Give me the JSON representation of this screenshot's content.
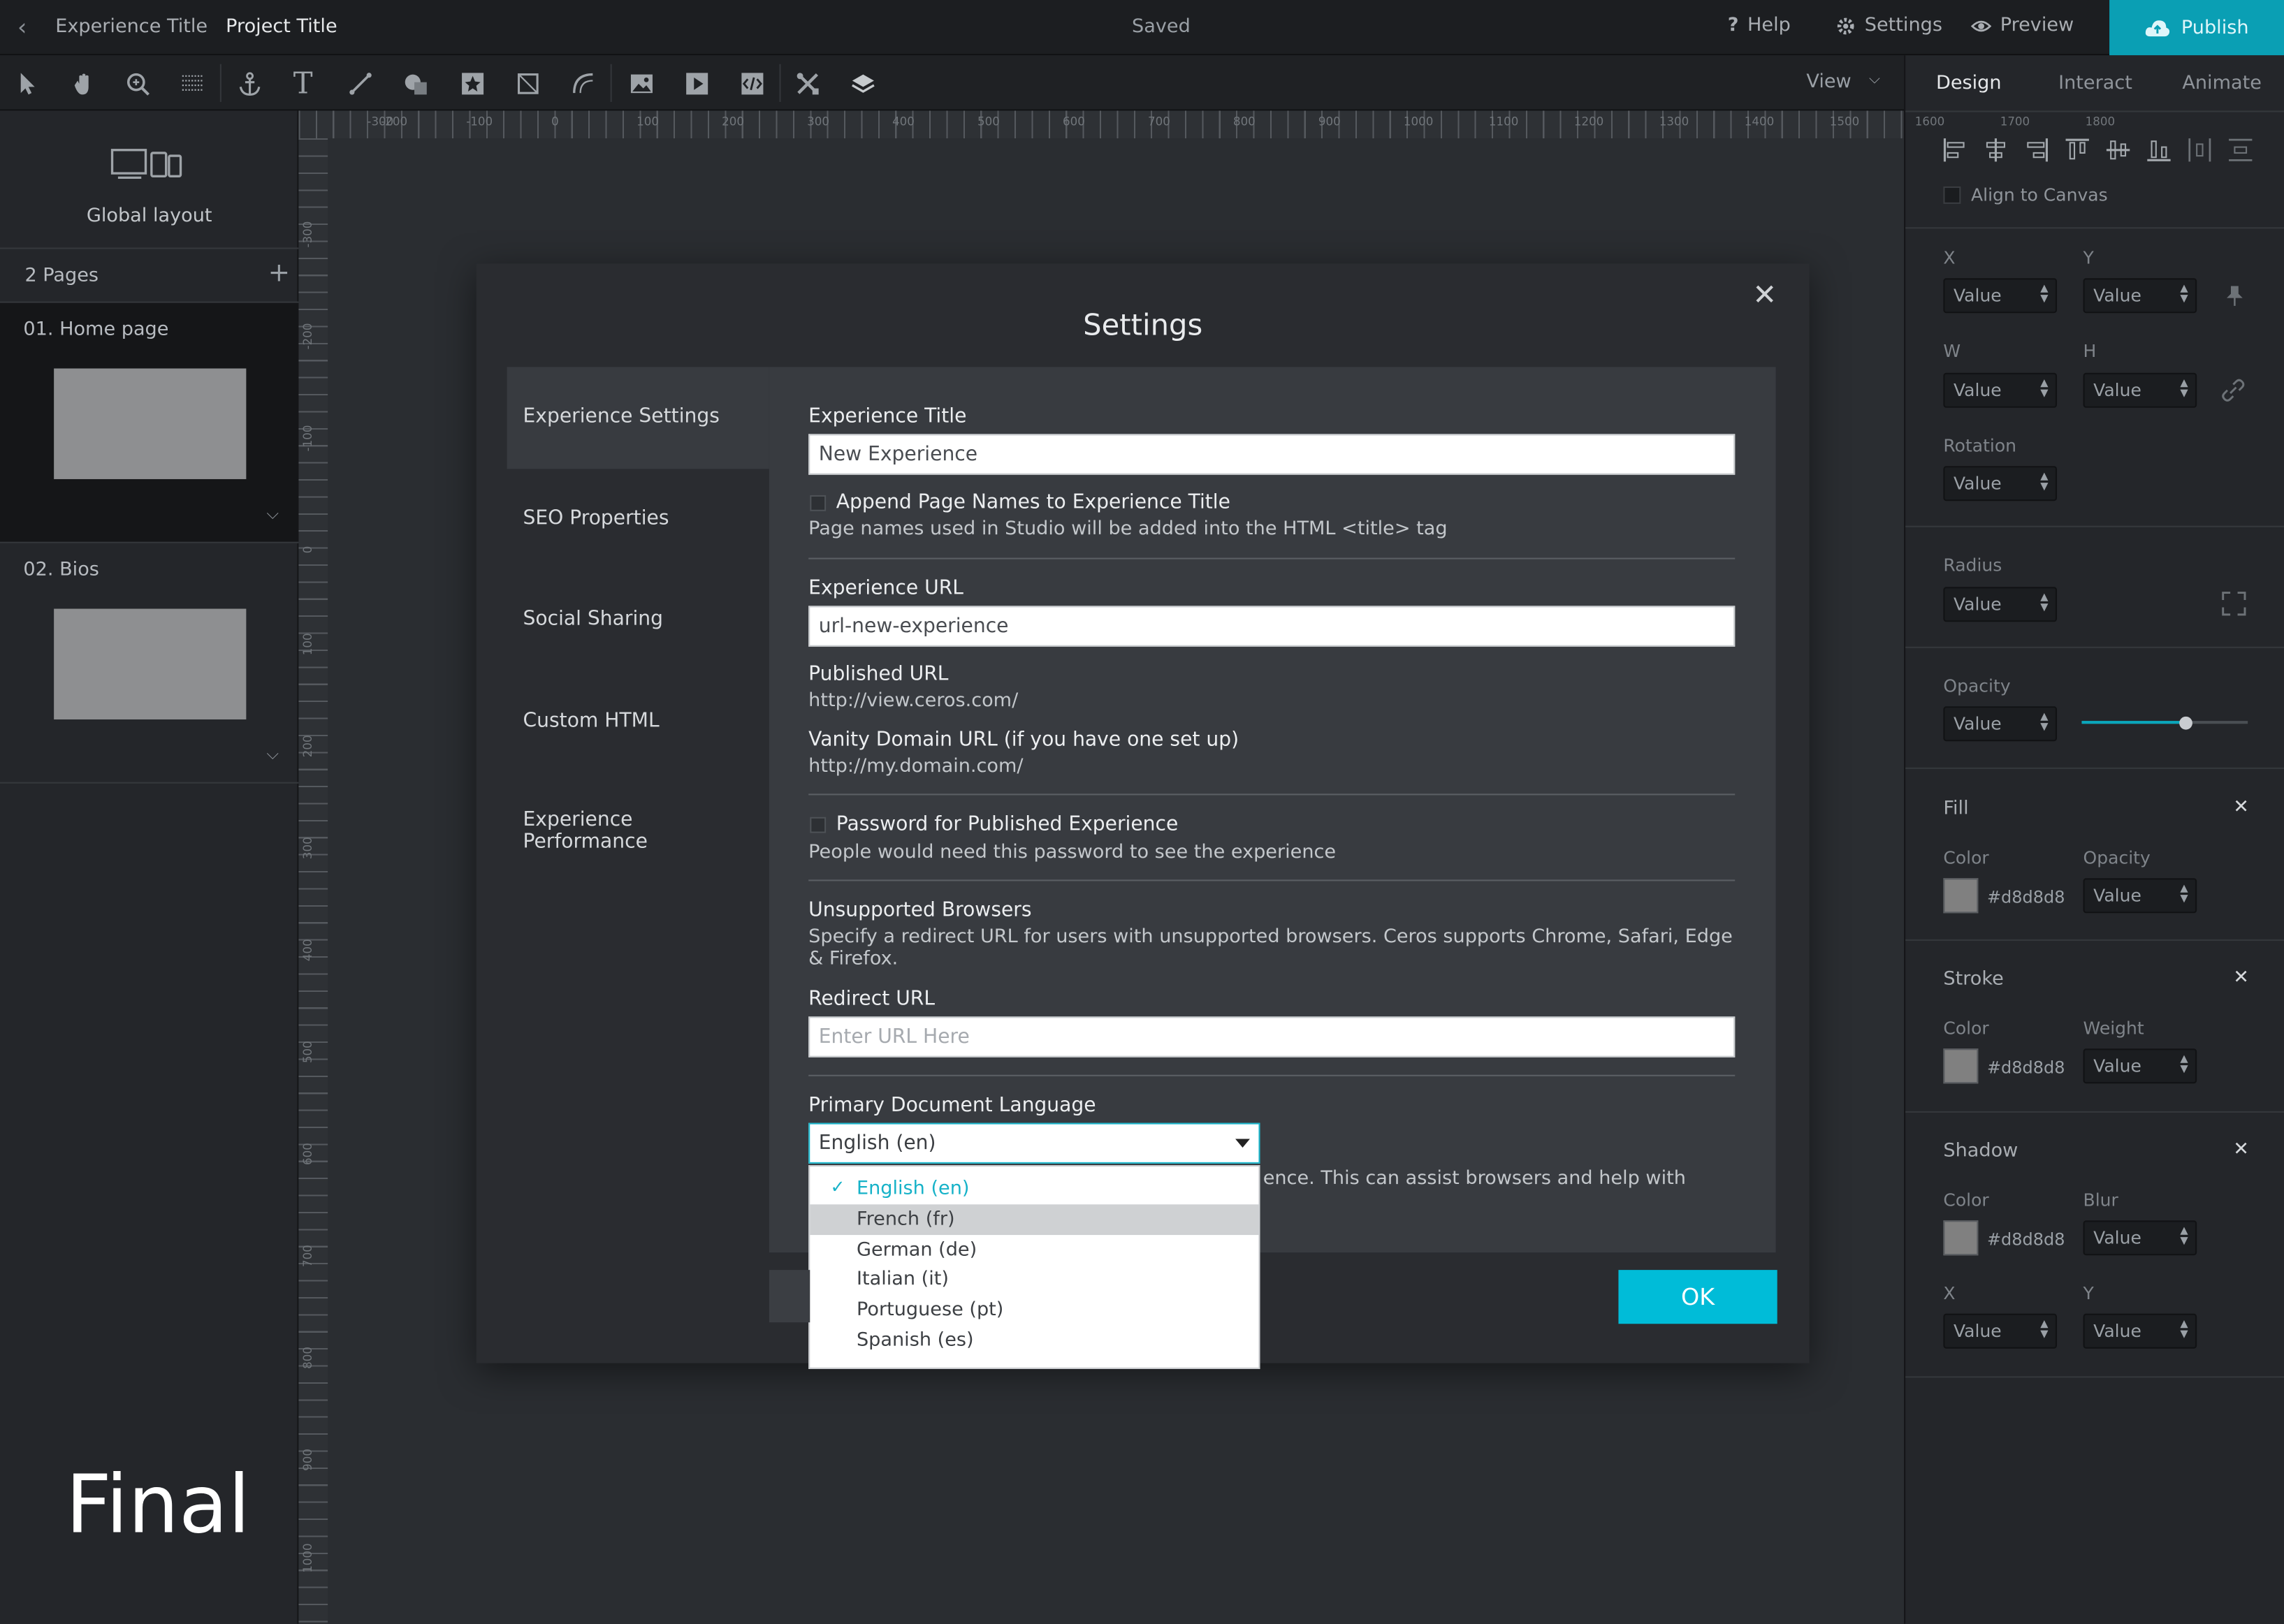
{
  "topbar": {
    "back_icon": "chevron-left-icon",
    "experience_title": "Experience Title",
    "project_title": "Project Title",
    "status": "Saved",
    "help": "Help",
    "settings": "Settings",
    "preview": "Preview",
    "publish": "Publish"
  },
  "toolbar": {
    "tools": [
      "pointer-icon",
      "hand-icon",
      "zoom-icon",
      "grid-icon",
      "anchor-icon",
      "text-icon",
      "line-icon",
      "shapes-icon",
      "star-icon",
      "frame-icon",
      "path-icon",
      "image-icon",
      "video-icon",
      "embed-icon",
      "tools-icon",
      "layers-icon"
    ],
    "view": "View"
  },
  "left_panel": {
    "global_layout": "Global layout",
    "pages_count": "2 Pages",
    "pages": [
      {
        "label": "01. Home page"
      },
      {
        "label": "02. Bios"
      }
    ],
    "final_label": "Final"
  },
  "rulers": {
    "h": [
      "-300",
      "-200",
      "-100",
      "0",
      "100",
      "200",
      "300",
      "400",
      "500",
      "600",
      "700",
      "800",
      "900",
      "1000",
      "1100",
      "1200",
      "1300",
      "1400",
      "1500",
      "1600",
      "1700",
      "1800"
    ],
    "v": [
      "-300",
      "-200",
      "-100",
      "0",
      "100",
      "200",
      "300",
      "400",
      "500",
      "600",
      "700",
      "800",
      "900",
      "1000"
    ]
  },
  "right_panel": {
    "tabs": [
      "Design",
      "Interact",
      "Animate"
    ],
    "align_to_canvas": "Align to Canvas",
    "x": "X",
    "y": "Y",
    "w": "W",
    "h": "H",
    "rotation": "Rotation",
    "radius": "Radius",
    "opacity": "Opacity",
    "value": "Value",
    "opacity_level": 0.63,
    "fill": {
      "title": "Fill",
      "color_label": "Color",
      "opacity_label": "Opacity",
      "color": "#d8d8d8"
    },
    "stroke": {
      "title": "Stroke",
      "color_label": "Color",
      "weight_label": "Weight",
      "color": "#d8d8d8"
    },
    "shadow": {
      "title": "Shadow",
      "color_label": "Color",
      "blur_label": "Blur",
      "x_label": "X",
      "y_label": "Y",
      "color": "#d8d8d8"
    }
  },
  "modal": {
    "title": "Settings",
    "nav": [
      "Experience Settings",
      "SEO Properties",
      "Social Sharing",
      "Custom HTML",
      "Experience Performance"
    ],
    "experience_title_label": "Experience Title",
    "experience_title_value": "New Experience",
    "append_label": "Append Page Names to Experience Title",
    "append_help": "Page names used in Studio will be added into the HTML <title> tag",
    "experience_url_label": "Experience URL",
    "experience_url_value": "url-new-experience",
    "published_url_label": "Published URL",
    "published_url_value": "http://view.ceros.com/",
    "vanity_label": "Vanity Domain URL (if you have one set up)",
    "vanity_value": "http://my.domain.com/",
    "password_label": "Password for Published Experience",
    "password_help": "People would need this password to see the experience",
    "unsupported_label": "Unsupported Browsers",
    "unsupported_help": "Specify a redirect URL for users with unsupported browsers. Ceros supports Chrome, Safari, Edge & Firefox.",
    "redirect_label": "Redirect URL",
    "redirect_placeholder": "Enter URL Here",
    "language_label": "Primary Document Language",
    "language_selected": "English (en)",
    "language_help_fragment": "ence. This can assist browsers and help with",
    "language_options": [
      "English (en)",
      "French (fr)",
      "German (de)",
      "Italian (it)",
      "Portuguese (pt)",
      "Spanish (es)"
    ],
    "ok": "OK"
  },
  "colors": {
    "accent": "#00bcd8",
    "publish": "#0a9fb4"
  }
}
